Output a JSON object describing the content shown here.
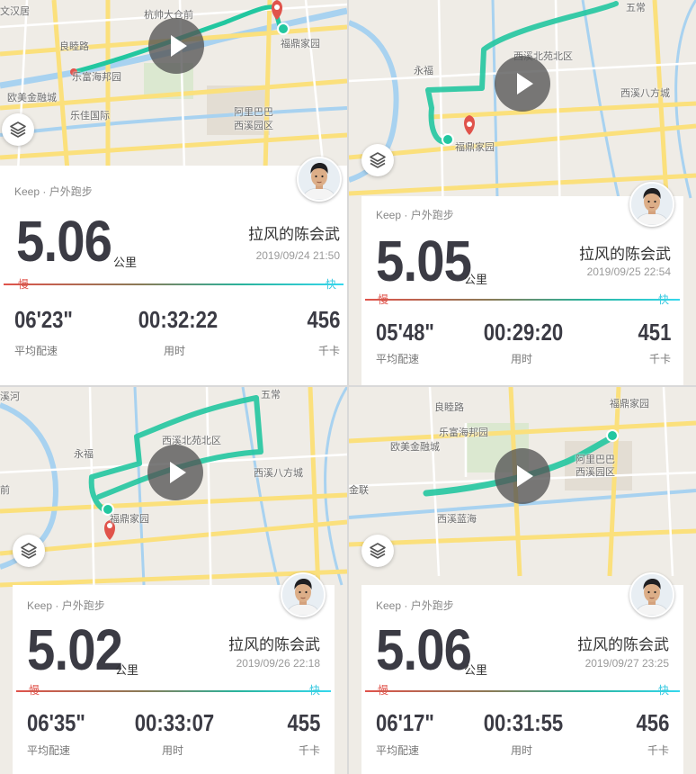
{
  "colors": {
    "track": "#22c7a0",
    "slow": "#e0534b",
    "fast": "#35d8ee",
    "road": "#fbe07c",
    "water": "#a8d2f0"
  },
  "panels": [
    {
      "map_labels": [
        "文汉居",
        "杭帅大仓前",
        "良睦路",
        "福鼎家园",
        "乐富海邦园",
        "欧美金融城",
        "乐佳国际",
        "阿里巴巴",
        "西溪园区"
      ],
      "source": "Keep · 户外跑步",
      "distance": "5.06",
      "unit": "公里",
      "user": "拉风的陈会武",
      "date": "2019/09/24 21:50",
      "slow": "慢",
      "fast": "快",
      "pace": "06'23\"",
      "pace_label": "平均配速",
      "duration": "00:32:22",
      "duration_label": "用时",
      "calories": "456",
      "calories_label": "千卡"
    },
    {
      "map_labels": [
        "五常",
        "永福",
        "西溪北苑北区",
        "西溪八方城",
        "福鼎家园"
      ],
      "source": "Keep · 户外跑步",
      "distance": "5.05",
      "unit": "公里",
      "user": "拉风的陈会武",
      "date": "2019/09/25 22:54",
      "slow": "慢",
      "fast": "快",
      "pace": "05'48\"",
      "pace_label": "平均配速",
      "duration": "00:29:20",
      "duration_label": "用时",
      "calories": "451",
      "calories_label": "千卡"
    },
    {
      "map_labels": [
        "溪河",
        "五常",
        "永福",
        "西溪北苑北区",
        "西溪八方城",
        "前",
        "福鼎家园"
      ],
      "source": "Keep · 户外跑步",
      "distance": "5.02",
      "unit": "公里",
      "user": "拉风的陈会武",
      "date": "2019/09/26 22:18",
      "slow": "慢",
      "fast": "快",
      "pace": "06'35\"",
      "pace_label": "平均配速",
      "duration": "00:33:07",
      "duration_label": "用时",
      "calories": "455",
      "calories_label": "千卡"
    },
    {
      "map_labels": [
        "良睦路",
        "福鼎家园",
        "乐富海邦园",
        "欧美金融城",
        "阿里巴巴",
        "西溪园区",
        "西溪蓝海",
        "金联"
      ],
      "source": "Keep · 户外跑步",
      "distance": "5.06",
      "unit": "公里",
      "user": "拉风的陈会武",
      "date": "2019/09/27 23:25",
      "slow": "慢",
      "fast": "快",
      "pace": "06'17\"",
      "pace_label": "平均配速",
      "duration": "00:31:55",
      "duration_label": "用时",
      "calories": "456",
      "calories_label": "千卡"
    }
  ]
}
